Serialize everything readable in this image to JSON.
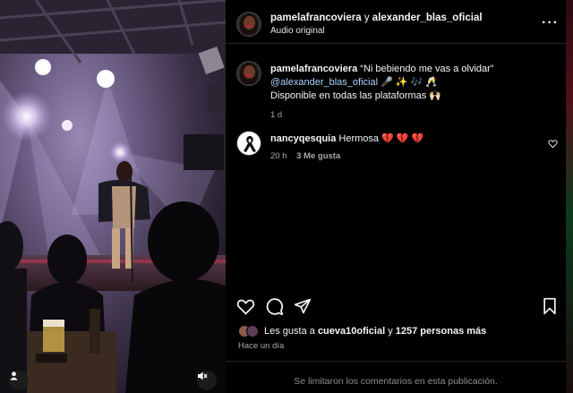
{
  "post": {
    "author": "pamelafrancoviera",
    "connector": "y",
    "coauthor": "alexander_blas_oficial",
    "audio": "Audio original"
  },
  "caption": {
    "username": "pamelafrancoviera",
    "title": "“Ni bebiendo me vas a olvidar”",
    "mention": "@alexander_blas_oficial",
    "emojis": "🎤 ✨ 🎶 🥂",
    "line2": "Disponible en todas las plataformas 🙌🏻",
    "time": "1 d"
  },
  "comment": {
    "username": "nancyqesquia",
    "text": "Hermosa 💔 💔 💔",
    "time": "20 h",
    "likes": "3 Me gusta"
  },
  "likes": {
    "prefix": "Les gusta a",
    "user": "cueva10oficial",
    "middle": "y",
    "others": "1257 personas más"
  },
  "posted_ago": "Hace un día",
  "comments_limited": "Se limitaron los comentarios en esta publicación.",
  "icons": {
    "like": "heart-icon",
    "comment": "comment-icon",
    "share": "share-icon",
    "save": "bookmark-icon",
    "mute": "muted-speaker-icon",
    "tags": "user-tag-icon"
  }
}
